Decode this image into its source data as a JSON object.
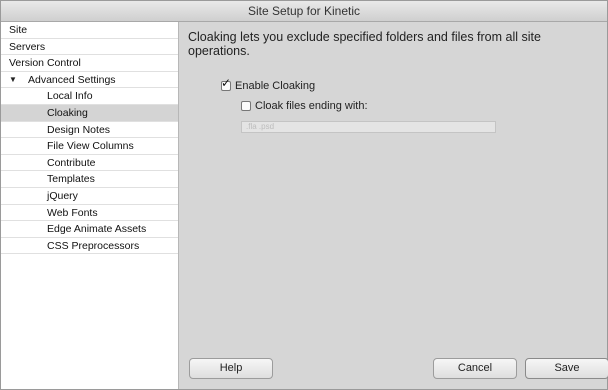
{
  "window": {
    "title": "Site Setup for Kinetic"
  },
  "sidebar": {
    "items": [
      {
        "label": "Site"
      },
      {
        "label": "Servers"
      },
      {
        "label": "Version Control"
      },
      {
        "label": "Advanced Settings",
        "expanded": true
      },
      {
        "label": "Local Info"
      },
      {
        "label": "Cloaking",
        "selected": true
      },
      {
        "label": "Design Notes"
      },
      {
        "label": "File View Columns"
      },
      {
        "label": "Contribute"
      },
      {
        "label": "Templates"
      },
      {
        "label": "jQuery"
      },
      {
        "label": "Web Fonts"
      },
      {
        "label": "Edge Animate Assets"
      },
      {
        "label": "CSS Preprocessors"
      }
    ]
  },
  "main": {
    "description": "Cloaking lets you exclude specified folders and files from all site operations.",
    "enable_cloaking": {
      "label": "Enable Cloaking",
      "checked": true
    },
    "cloak_files": {
      "label": "Cloak files ending with:",
      "checked": false
    },
    "extensions_field": {
      "value": ".fla .psd",
      "disabled": true
    }
  },
  "buttons": {
    "help": "Help",
    "cancel": "Cancel",
    "save": "Save"
  },
  "icons": {
    "disclosure": "disclosure-triangle-expanded-icon",
    "checkmark": "checkmark-icon"
  }
}
